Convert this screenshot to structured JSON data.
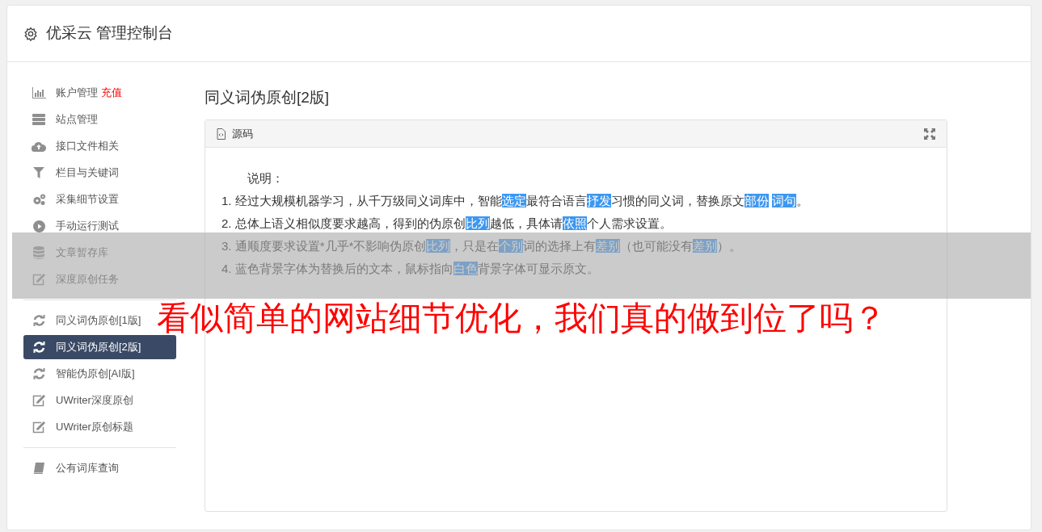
{
  "header": {
    "title": "优采云 管理控制台"
  },
  "sidebar": {
    "groups": [
      {
        "items": [
          {
            "label": "账户管理",
            "badge": "充值",
            "selected": false
          },
          {
            "label": "站点管理",
            "selected": false
          },
          {
            "label": "接口文件相关",
            "selected": false
          },
          {
            "label": "栏目与关键词",
            "selected": false
          },
          {
            "label": "采集细节设置",
            "selected": false
          },
          {
            "label": "手动运行测试",
            "selected": false
          },
          {
            "label": "文章暂存库",
            "selected": false
          },
          {
            "label": "深度原创任务",
            "selected": false
          }
        ]
      },
      {
        "items": [
          {
            "label": "同义词伪原创[1版]",
            "selected": false
          },
          {
            "label": "同义词伪原创[2版]",
            "selected": true
          },
          {
            "label": "智能伪原创[AI版]",
            "selected": false
          },
          {
            "label": "UWriter深度原创",
            "selected": false
          },
          {
            "label": "UWriter原创标题",
            "selected": false
          }
        ]
      },
      {
        "items": [
          {
            "label": "公有词库查询",
            "selected": false
          }
        ]
      }
    ]
  },
  "main": {
    "title": "同义词伪原创[2版]",
    "panel": {
      "tab": "源码",
      "heading": "说明：",
      "lines": [
        [
          {
            "text": "1. 经过大规模机器学习，从千万级同义词库中，智能",
            "highlight": false
          },
          {
            "text": "选定",
            "highlight": true
          },
          {
            "text": "最符合语言",
            "highlight": false
          },
          {
            "text": "抒发",
            "highlight": true
          },
          {
            "text": "习惯的同义词，替换原文",
            "highlight": false
          },
          {
            "text": "部份",
            "highlight": true
          },
          {
            "text": "词句",
            "highlight": true
          },
          {
            "text": "。",
            "highlight": false
          }
        ],
        [
          {
            "text": "2. 总体上语义相似度要求越高，得到的伪原创",
            "highlight": false
          },
          {
            "text": "比列",
            "highlight": true
          },
          {
            "text": "越低，具体请",
            "highlight": false
          },
          {
            "text": "依照",
            "highlight": true
          },
          {
            "text": "个人需求设置。",
            "highlight": false
          }
        ],
        [
          {
            "text": "3. 通顺度要求设置*几乎*不影响伪原创",
            "highlight": false
          },
          {
            "text": "比列",
            "highlight": true
          },
          {
            "text": "，只是在",
            "highlight": false
          },
          {
            "text": "个别",
            "highlight": true
          },
          {
            "text": "词的选择上有",
            "highlight": false
          },
          {
            "text": "差别",
            "highlight": true
          },
          {
            "text": "（也可能没有",
            "highlight": false
          },
          {
            "text": "差别",
            "highlight": true
          },
          {
            "text": "）。",
            "highlight": false
          }
        ],
        [
          {
            "text": "4. 蓝色背景字体为替换后的文本，鼠标指向",
            "highlight": false
          },
          {
            "text": "白色",
            "highlight": true
          },
          {
            "text": "背景字体可显示原文。",
            "highlight": false
          }
        ]
      ]
    }
  },
  "overlay": {
    "caption": "看似简单的网站细节优化，我们真的做到位了吗？"
  }
}
